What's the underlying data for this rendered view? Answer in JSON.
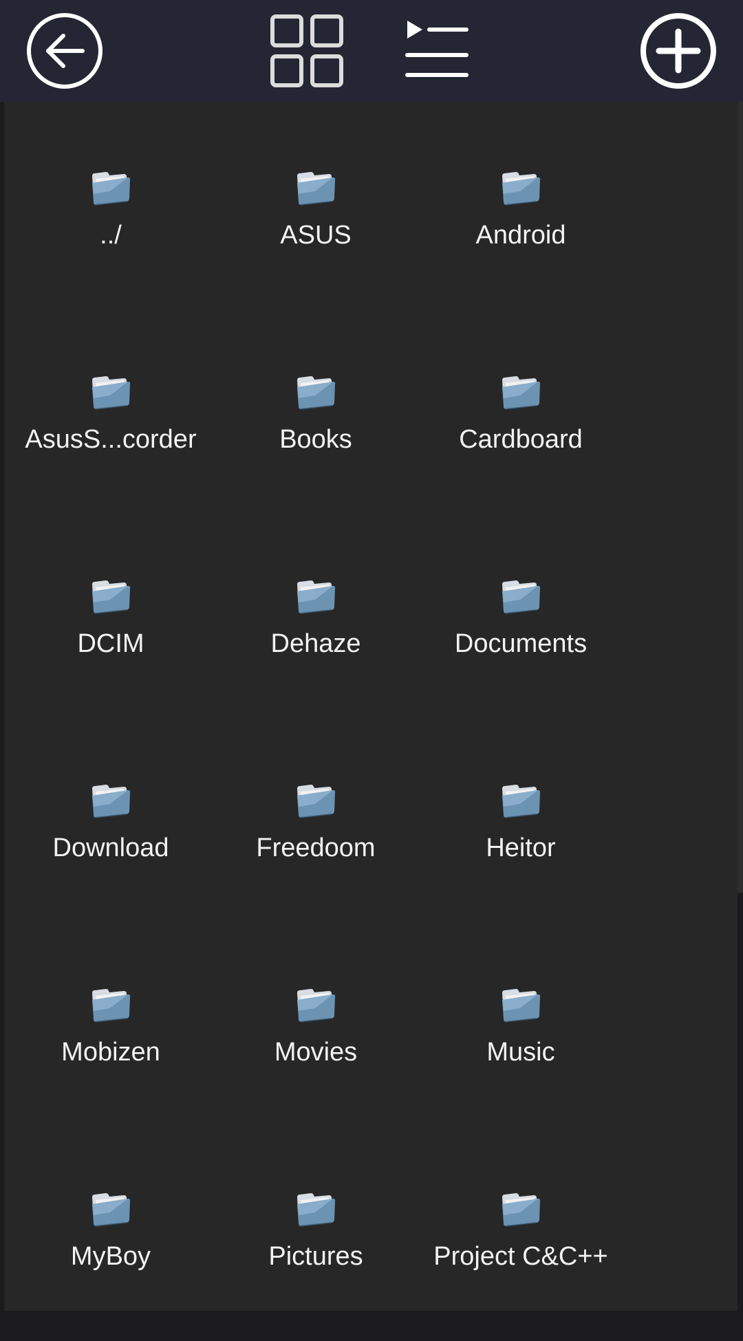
{
  "toolbar": {
    "back_icon": "back-arrow-circle-icon",
    "grid_view_icon": "grid-view-icon",
    "list_view_icon": "list-view-icon",
    "add_icon": "add-circle-icon",
    "colors": {
      "toolbar_bg": "#252634",
      "panel_bg": "#272727",
      "icon_fg": "#ffffff",
      "folder_blue": "#6d93b3"
    }
  },
  "folders": [
    {
      "label": "../",
      "icon": "folder-icon"
    },
    {
      "label": "ASUS",
      "icon": "folder-icon"
    },
    {
      "label": "Android",
      "icon": "folder-icon"
    },
    {
      "label": "AsusS...corder",
      "icon": "folder-icon"
    },
    {
      "label": "Books",
      "icon": "folder-icon"
    },
    {
      "label": "Cardboard",
      "icon": "folder-icon"
    },
    {
      "label": "DCIM",
      "icon": "folder-icon"
    },
    {
      "label": "Dehaze",
      "icon": "folder-icon"
    },
    {
      "label": "Documents",
      "icon": "folder-icon"
    },
    {
      "label": "Download",
      "icon": "folder-icon"
    },
    {
      "label": "Freedoom",
      "icon": "folder-icon"
    },
    {
      "label": "Heitor",
      "icon": "folder-icon"
    },
    {
      "label": "Mobizen",
      "icon": "folder-icon"
    },
    {
      "label": "Movies",
      "icon": "folder-icon"
    },
    {
      "label": "Music",
      "icon": "folder-icon"
    },
    {
      "label": "MyBoy",
      "icon": "folder-icon"
    },
    {
      "label": "Pictures",
      "icon": "folder-icon"
    },
    {
      "label": "Project C&C++",
      "icon": "folder-icon"
    }
  ]
}
